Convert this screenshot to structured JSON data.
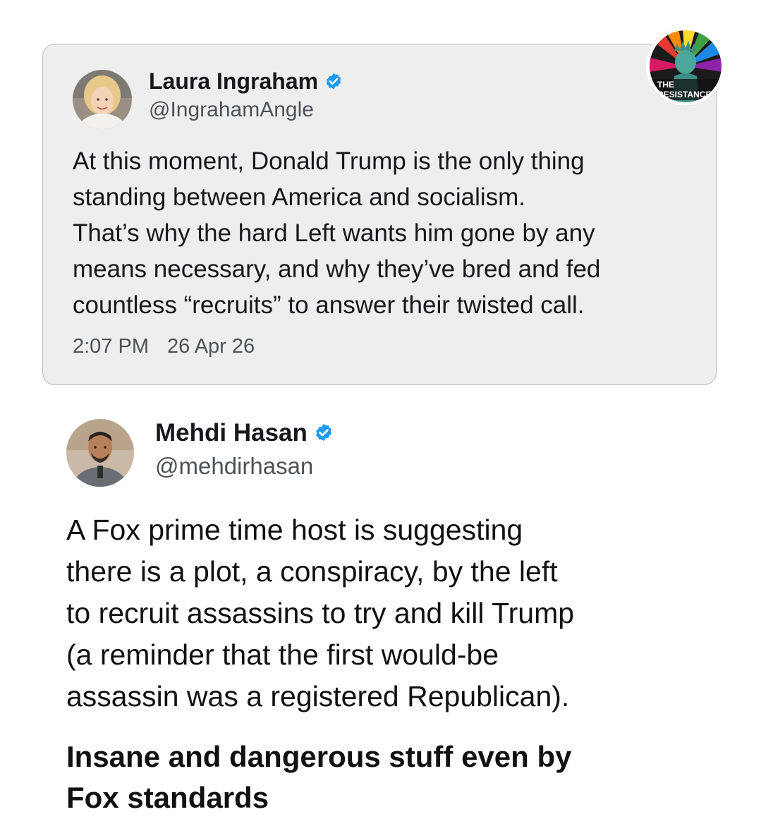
{
  "badge": {
    "line1": "THE",
    "line2": "RESISTANCE"
  },
  "quoted_tweet": {
    "author_name": "Laura Ingraham",
    "handle": "@IngrahamAngle",
    "verified": true,
    "text_lines": [
      "At this moment, Donald Trump is the only thing",
      "standing between America and socialism.",
      "That’s why the hard Left wants him gone by any",
      "means necessary, and why they’ve bred and fed",
      "countless “recruits” to answer their twisted call."
    ],
    "time": "2:07 PM",
    "date": "26 Apr 26"
  },
  "main_tweet": {
    "author_name": "Mehdi Hasan",
    "handle": "@mehdirhasan",
    "verified": true,
    "text_lines": [
      "A Fox prime time host is suggesting",
      "there is a plot, a conspiracy, by the left",
      "to recruit assassins to try and kill Trump",
      "(a reminder that the first would-be",
      "assassin was a registered Republican)."
    ],
    "emphasis_lines": [
      "Insane and dangerous stuff even by",
      "Fox standards"
    ]
  },
  "colors": {
    "verified_badge": "#1d9bf0",
    "quoted_card_bg": "#eeeeee",
    "secondary_text": "#4d5257"
  },
  "icons": {
    "verified": "verified-check-icon"
  }
}
